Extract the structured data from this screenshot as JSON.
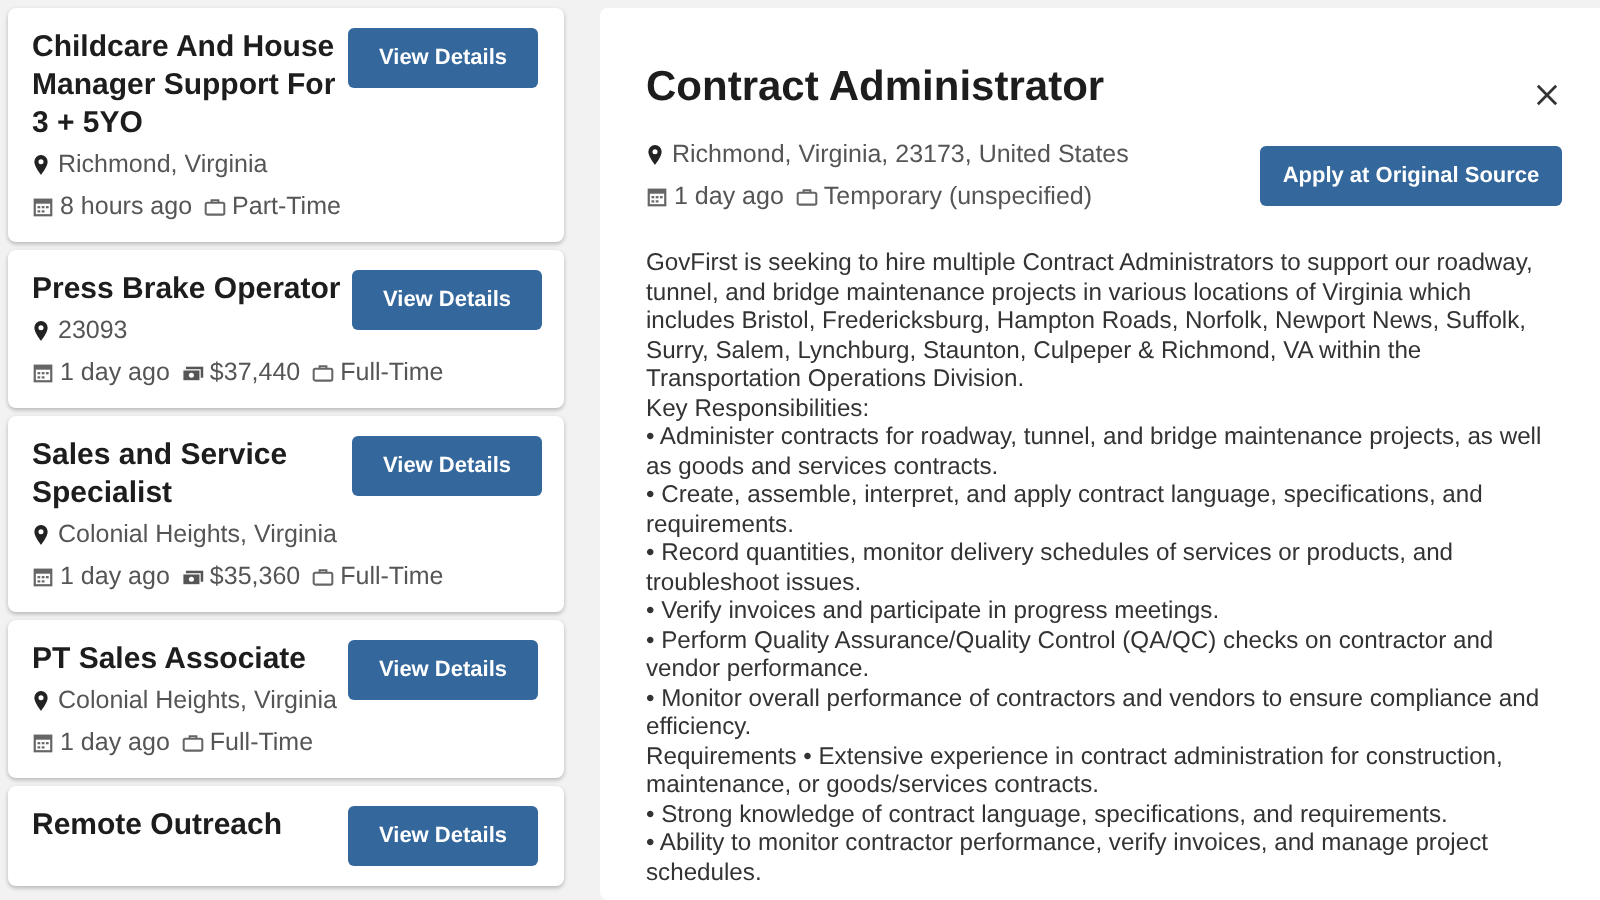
{
  "jobs": [
    {
      "title": "Childcare And House Manager Support For 3 + 5YO",
      "button": "View Details",
      "location": "Richmond, Virginia",
      "meta": [
        {
          "kind": "date",
          "text": "8 hours ago"
        },
        {
          "kind": "type",
          "text": "Part-Time"
        }
      ]
    },
    {
      "title": "Press Brake Operator",
      "button": "View Details",
      "location": "23093",
      "meta": [
        {
          "kind": "date",
          "text": "1 day ago"
        },
        {
          "kind": "salary",
          "text": "$37,440"
        },
        {
          "kind": "type",
          "text": "Full-Time"
        }
      ]
    },
    {
      "title": "Sales and Service Specialist",
      "button": "View Details",
      "location": "Colonial Heights, Virginia",
      "meta": [
        {
          "kind": "date",
          "text": "1 day ago"
        },
        {
          "kind": "salary",
          "text": "$35,360"
        },
        {
          "kind": "type",
          "text": "Full-Time"
        }
      ]
    },
    {
      "title": "PT Sales Associate",
      "button": "View Details",
      "location": "Colonial Heights, Virginia",
      "meta": [
        {
          "kind": "date",
          "text": "1 day ago"
        },
        {
          "kind": "type",
          "text": "Full-Time"
        }
      ]
    },
    {
      "title": "Remote Outreach",
      "button": "View Details"
    }
  ],
  "detail": {
    "title": "Contract Administrator",
    "location": "Richmond, Virginia, 23173, United States",
    "meta": [
      {
        "kind": "date",
        "text": "1 day ago"
      },
      {
        "kind": "type",
        "text": "Temporary (unspecified)"
      }
    ],
    "apply_button": "Apply at Original Source",
    "description": [
      "GovFirst is seeking to hire multiple Contract Administrators to support our roadway, tunnel, and bridge maintenance projects in various locations of Virginia which includes Bristol, Fredericksburg, Hampton Roads, Norfolk, Newport News, Suffolk, Surry, Salem, Lynchburg, Staunton, Culpeper & Richmond, VA within the Transportation Operations Division.",
      "Key Responsibilities:",
      "• Administer contracts for roadway, tunnel, and bridge maintenance projects, as well as goods and services contracts.",
      "• Create, assemble, interpret, and apply contract language, specifications, and requirements.",
      "• Record quantities, monitor delivery schedules of services or products, and troubleshoot issues.",
      "• Verify invoices and participate in progress meetings.",
      "• Perform Quality Assurance/Quality Control (QA/QC) checks on contractor and vendor performance.",
      "• Monitor overall performance of contractors and vendors to ensure compliance and efficiency.",
      "Requirements • Extensive experience in contract administration for construction, maintenance, or goods/services contracts.",
      "• Strong knowledge of contract language, specifications, and requirements.",
      "• Ability to monitor contractor performance, verify invoices, and manage project schedules."
    ]
  }
}
